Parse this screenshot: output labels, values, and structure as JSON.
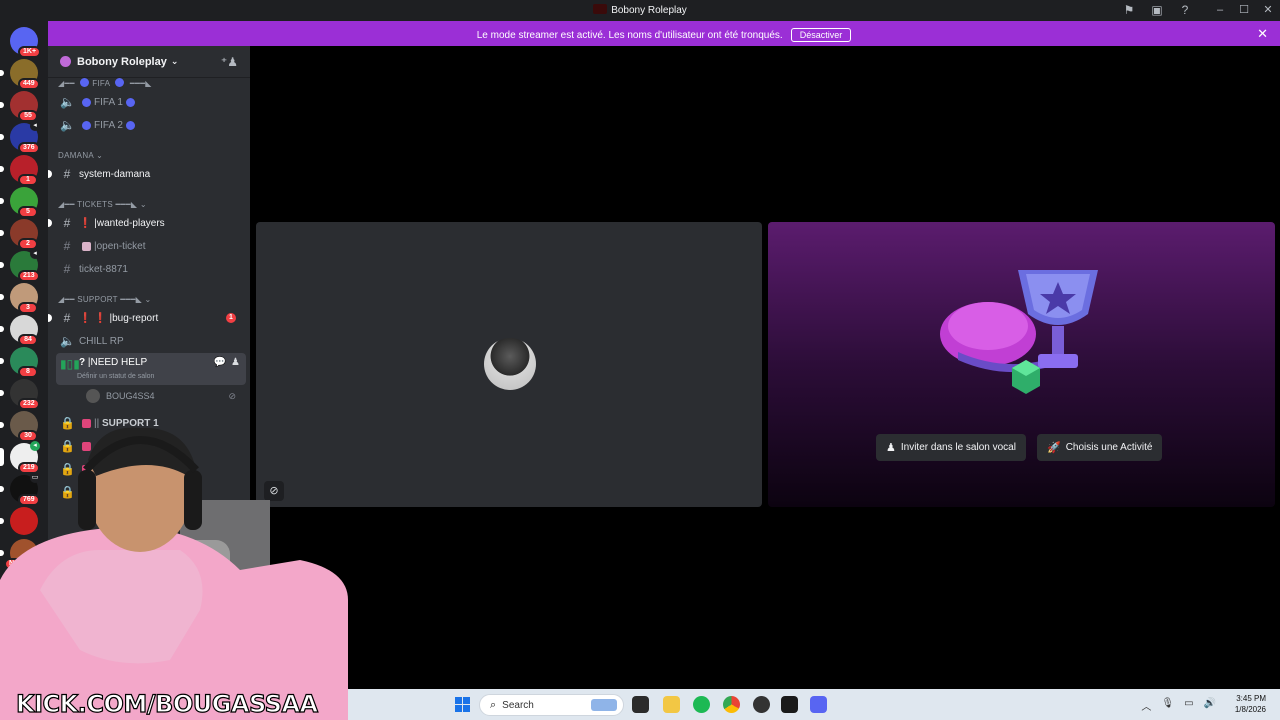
{
  "window": {
    "title": "Bobony Roleplay"
  },
  "notice": {
    "text": "Le mode streamer est activé. Les noms d'utilisateur ont été tronqués.",
    "button": "Désactiver"
  },
  "guilds": [
    {
      "badge": "1K+"
    },
    {
      "badge": "449"
    },
    {
      "badge": "55"
    },
    {
      "badge": "376"
    },
    {
      "badge": "1"
    },
    {
      "badge": "5"
    },
    {
      "badge": "2"
    },
    {
      "badge": "213"
    },
    {
      "badge": "3"
    },
    {
      "badge": "84"
    },
    {
      "badge": "8"
    },
    {
      "badge": "232"
    },
    {
      "badge": "30"
    },
    {
      "badge": "219"
    },
    {
      "badge": "769"
    },
    {
      "badge": ""
    },
    {
      "badge": "NOUVEAU"
    }
  ],
  "server": {
    "name": "Bobony Roleplay"
  },
  "channels": {
    "fifa_category": "FIFA",
    "fifa1": "FIFA 1",
    "fifa2": "FIFA 2",
    "damana_category": "DAMANA",
    "system_damana": "system-damana",
    "tickets_category": "TICKETS",
    "wanted_players": "wanted-players",
    "open_ticket": "open-ticket",
    "ticket_8871": "ticket-8871",
    "support_category": "SUPPORT",
    "bug_report": "bug-report",
    "bug_report_mentions": "1",
    "chill_rp": "CHILL RP",
    "need_help": "NEED HELP",
    "need_help_status": "Définir un statut de salon",
    "voice_user": "BOUG4SS4",
    "support1": "SUPPORT 1"
  },
  "stage": {
    "invite_button": "Inviter dans le salon vocal",
    "activity_button": "Choisis une Activité"
  },
  "overlay": {
    "kick": "KICK.COM/BOUGASSAA"
  },
  "taskbar": {
    "search_placeholder": "Search",
    "time": "3:45 PM",
    "date": "1/8/2026"
  }
}
